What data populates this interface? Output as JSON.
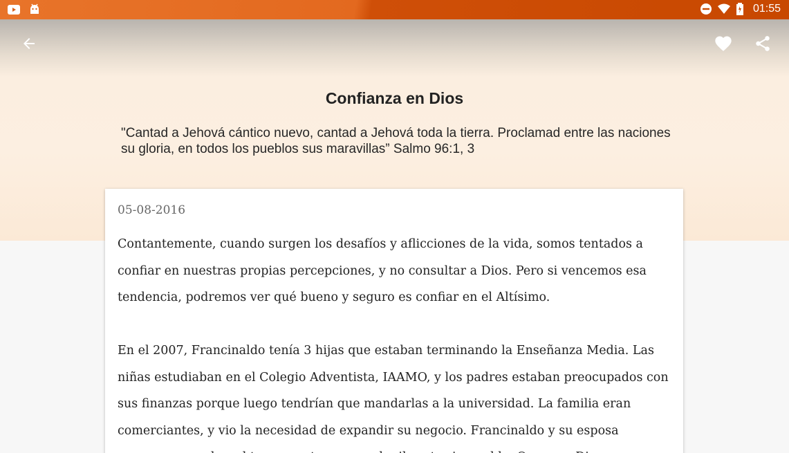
{
  "status_bar": {
    "time": "01:55",
    "left_icons": [
      "youtube-icon",
      "android-icon"
    ],
    "right_icons": [
      "do-not-disturb-icon",
      "wifi-icon",
      "battery-icon"
    ]
  },
  "toolbar": {
    "back_icon": "arrow-back-icon",
    "favorite_icon": "heart-icon",
    "share_icon": "share-icon"
  },
  "devotional": {
    "title": "Confianza en Dios",
    "verse": "\"Cantad a Jehová cántico nuevo, cantad a Jehová toda la tierra. Proclamad entre las naciones su gloria, en todos los pueblos sus maravillas” Salmo 96:1, 3",
    "date": "05-08-2016",
    "paragraphs": [
      "Contantemente, cuando surgen los desafíos y aflicciones de la vida, somos tentados a confiar en nuestras propias percepciones, y no consultar a Dios. Pero si vencemos esa tendencia, podremos ver qué bueno y seguro es confiar en el Altísimo.",
      "En el 2007, Francinaldo tenía 3 hijas que estaban terminando la Enseñanza Media. Las niñas estudiaban en el Colegio Adventista, IAAMO, y los padres estaban preocupados con sus finanzas porque luego tendrían que mandarlas a la universidad. La familia eran comerciantes, y vio la necesidad de expandir su negocio. Francinaldo y su esposa conversaron sobre el tema y optaron por alquilar otro inmueble. Oraron a Dios y"
    ]
  },
  "colors": {
    "status_bar": "#c84800",
    "header_bg": "#fcefe1",
    "page_bg": "#f7f7f7"
  }
}
